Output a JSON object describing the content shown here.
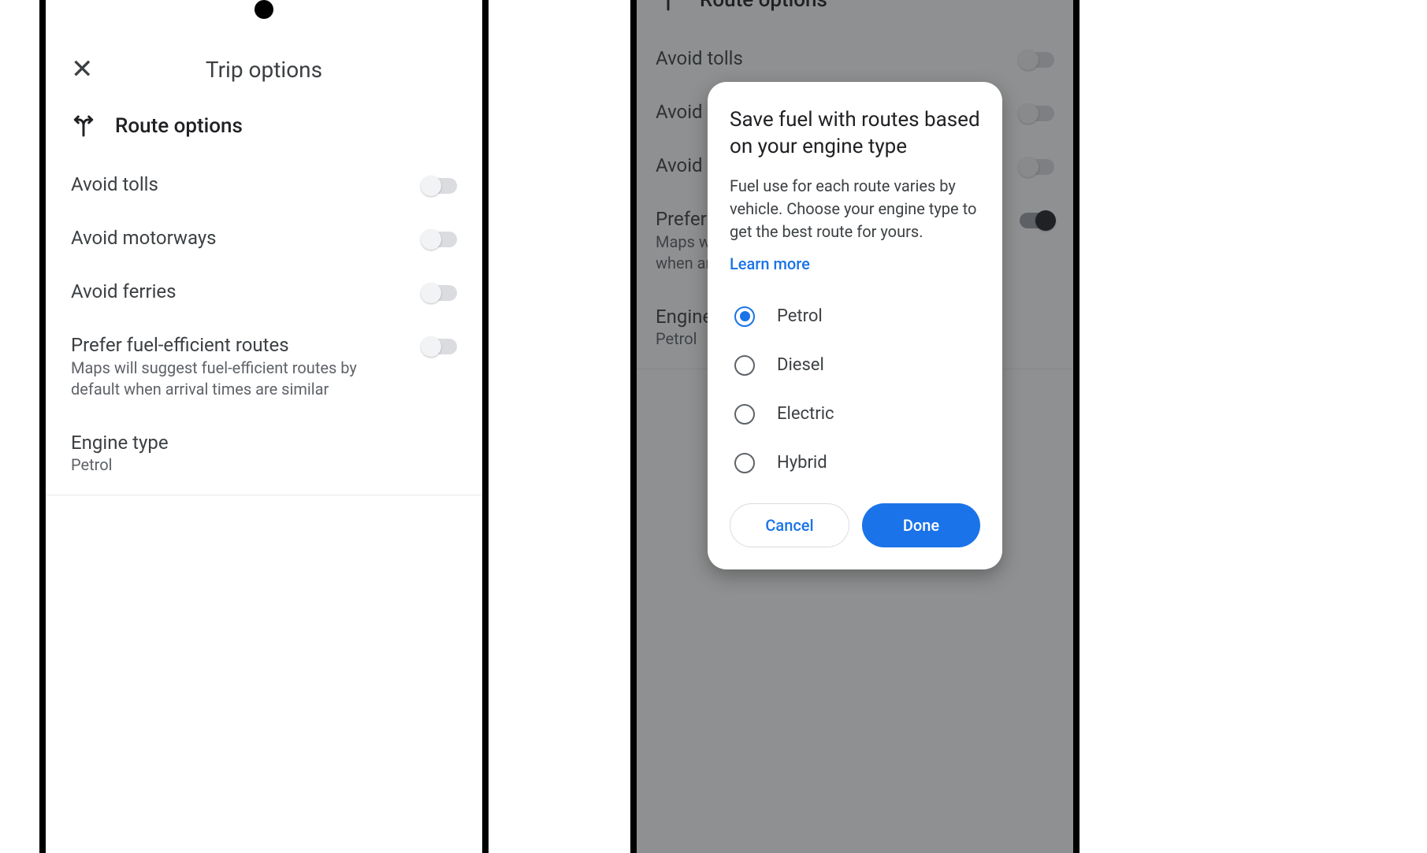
{
  "screen1": {
    "title": "Trip options",
    "section_title": "Route options",
    "rows": [
      {
        "label": "Avoid tolls"
      },
      {
        "label": "Avoid motorways"
      },
      {
        "label": "Avoid ferries"
      },
      {
        "label": "Prefer fuel-efficient routes",
        "sub": "Maps will suggest fuel-efficient routes by default when arrival times are similar"
      }
    ],
    "engine": {
      "label": "Engine type",
      "value": "Petrol"
    }
  },
  "screen2_bg": {
    "section_title": "Route options",
    "rows": [
      {
        "label": "Avoid tolls"
      },
      {
        "label": "Avoid motorways"
      },
      {
        "label": "Avoid ferries"
      },
      {
        "label": "Prefer fuel-efficient routes",
        "sub": "Maps will suggest fuel-efficient routes by default when arrival times are similar",
        "on": true
      }
    ],
    "engine": {
      "label": "Engine type",
      "value": "Petrol"
    }
  },
  "modal": {
    "title": "Save fuel with routes based on your engine type",
    "body": "Fuel use for each route varies by vehicle. Choose your engine type to get the best route for yours.",
    "learn_more": "Learn more",
    "options": [
      "Petrol",
      "Diesel",
      "Electric",
      "Hybrid"
    ],
    "selected": "Petrol",
    "cancel": "Cancel",
    "done": "Done"
  }
}
